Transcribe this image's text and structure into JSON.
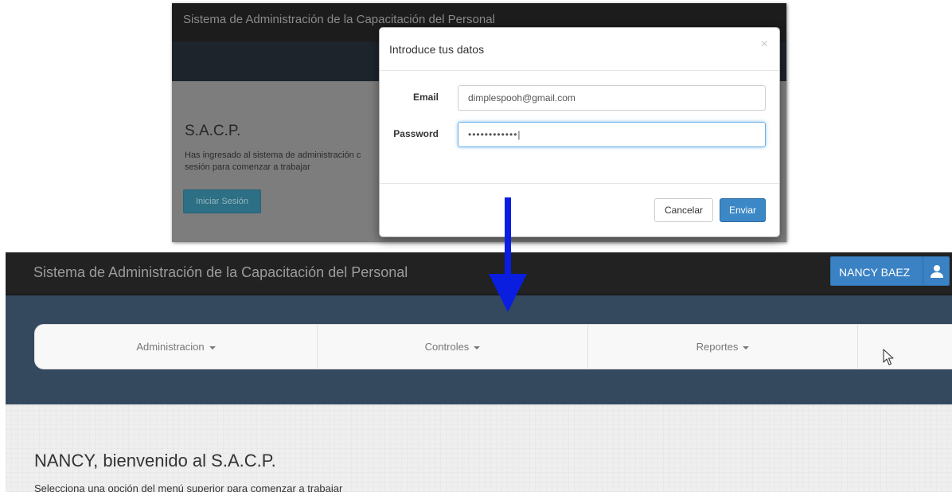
{
  "before": {
    "app_title": "Sistema de Administración de la Capacitación del Personal",
    "heading": "S.A.C.P.",
    "description_line1": "Has ingresado al sistema de administración c",
    "description_line2": "sesión para comenzar a trabajar",
    "login_button": "Iniciar Sesión",
    "modal": {
      "title": "Introduce tus datos",
      "close_symbol": "×",
      "email_label": "Email",
      "email_value": "dimplespooh@gmail.com",
      "password_label": "Password",
      "password_value": "••••••••••••|",
      "cancel_label": "Cancelar",
      "submit_label": "Enviar"
    }
  },
  "after": {
    "app_title": "Sistema de Administración de la Capacitación del Personal",
    "user_name": "NANCY BAEZ",
    "user_icon": "user-icon",
    "menu": [
      {
        "label": "Administracion"
      },
      {
        "label": "Controles"
      },
      {
        "label": "Reportes"
      }
    ],
    "welcome_title": "NANCY, bienvenido al S.A.C.P.",
    "welcome_subtitle": "Selecciona una opción del menú superior para comenzar a trabajar"
  },
  "colors": {
    "arrow": "#0a1ee0",
    "primary_button": "#3c87c6",
    "navbar": "#222222",
    "band": "#34495e"
  }
}
